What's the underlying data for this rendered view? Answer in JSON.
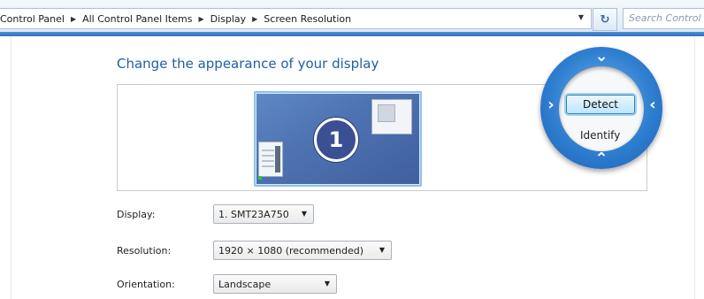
{
  "address_bar": {
    "breadcrumbs": [
      "Control Panel",
      "All Control Panel Items",
      "Display",
      "Screen Resolution"
    ],
    "refresh_glyph": "↻",
    "search_placeholder": "Search Control"
  },
  "page": {
    "title": "Change the appearance of your display",
    "monitor_number": "1"
  },
  "settings": {
    "display_label": "Display:",
    "display_value": "1. SMT23A750",
    "resolution_label": "Resolution:",
    "resolution_value": "1920 × 1080 (recommended)",
    "orientation_label": "Orientation:",
    "orientation_value": "Landscape"
  },
  "callout": {
    "detect_label": "Detect",
    "identify_label": "Identify"
  },
  "icons": {
    "breadcrumb_separator": "triangle-right-icon",
    "dropdown": "triangle-down-icon",
    "refresh": "refresh-icon",
    "callout_chevrons": [
      "chevron-down-icon",
      "chevron-up-icon",
      "chevron-right-icon",
      "chevron-left-icon"
    ]
  },
  "colors": {
    "accent_blue": "#2f7fd1",
    "title_blue": "#1e5fa8",
    "monitor_blue": "#4f73b2"
  }
}
